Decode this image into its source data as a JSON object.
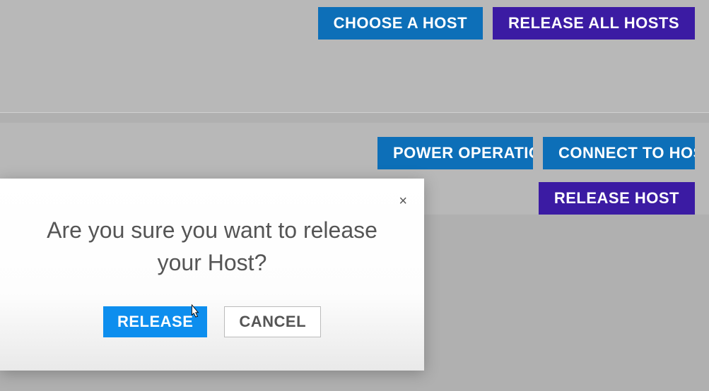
{
  "toolbar_top": {
    "choose_host": "CHOOSE A HOST",
    "release_all": "RELEASE ALL HOSTS"
  },
  "toolbar_bottom": {
    "power_operation": "POWER OPERATION",
    "connect_to_host": "CONNECT TO HOST",
    "release_host": "RELEASE HOST"
  },
  "modal": {
    "message": "Are you sure you want to release your Host?",
    "release": "RELEASE",
    "cancel": "CANCEL",
    "close": "×"
  }
}
